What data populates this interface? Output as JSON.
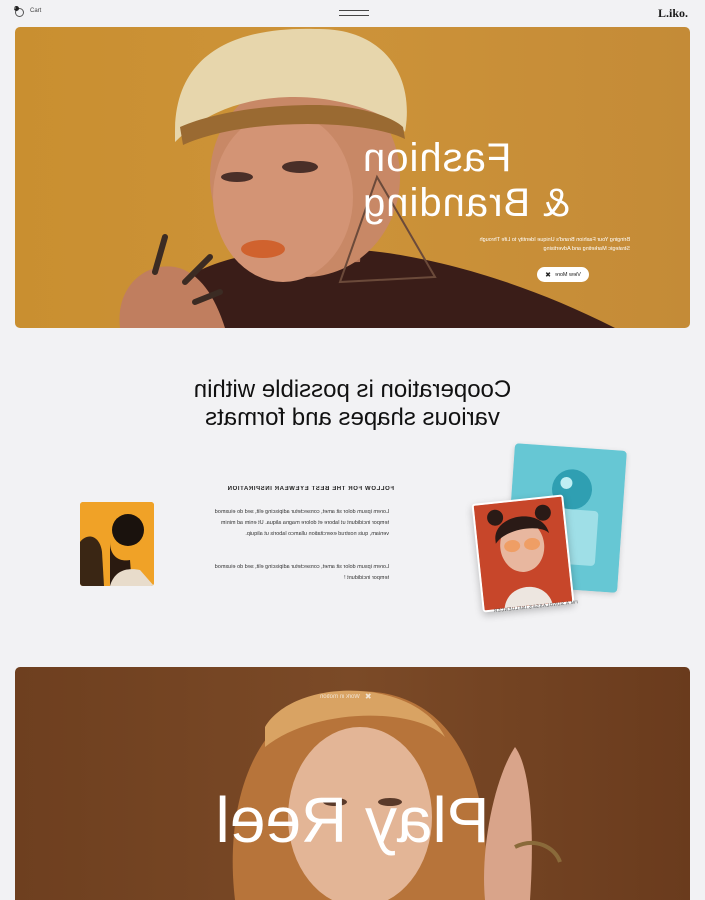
{
  "header": {
    "logo": "L.iko.",
    "cart_label": "Cart",
    "cart_count": "0"
  },
  "hero": {
    "title_line1": "Fashion",
    "title_line2": "& Branding",
    "description": "Bringing Your Fashion Brand's Unique Identity to Life Through Strategic Marketing and Advertising",
    "button_label": "View More"
  },
  "cooperation": {
    "line1": "Cooperation is possible within",
    "line2": "various shapes and formats"
  },
  "eyewear": {
    "heading": "FOLLOW FOR THE BEST EYEWEAR INSPIRATION",
    "paragraph1": "Lorem ipsum dolor sit amet, consectetur adipiscing elit, sed do eiusmod tempor incididunt ut labore et dolore magna aliqua. Ut enim ad minim veniam, quis nostrud exercitation ullamco laboris ut aliquip.",
    "paragraph2": "Lorem ipsum dolor sit amet, consectetur adipiscing elit, sed do eiusmod tempor incididunt !",
    "card_caption": "I'M A SUNGLASSES INFLUENCER"
  },
  "reel": {
    "badge_label": "Work in motion",
    "title": "Play Reel"
  },
  "colors": {
    "hero_bg": "#cd9339",
    "reel_bg": "#7b4a27",
    "thumb_bg": "#f0a227",
    "card_blue": "#58c1cf",
    "card_red": "#c7462a"
  }
}
